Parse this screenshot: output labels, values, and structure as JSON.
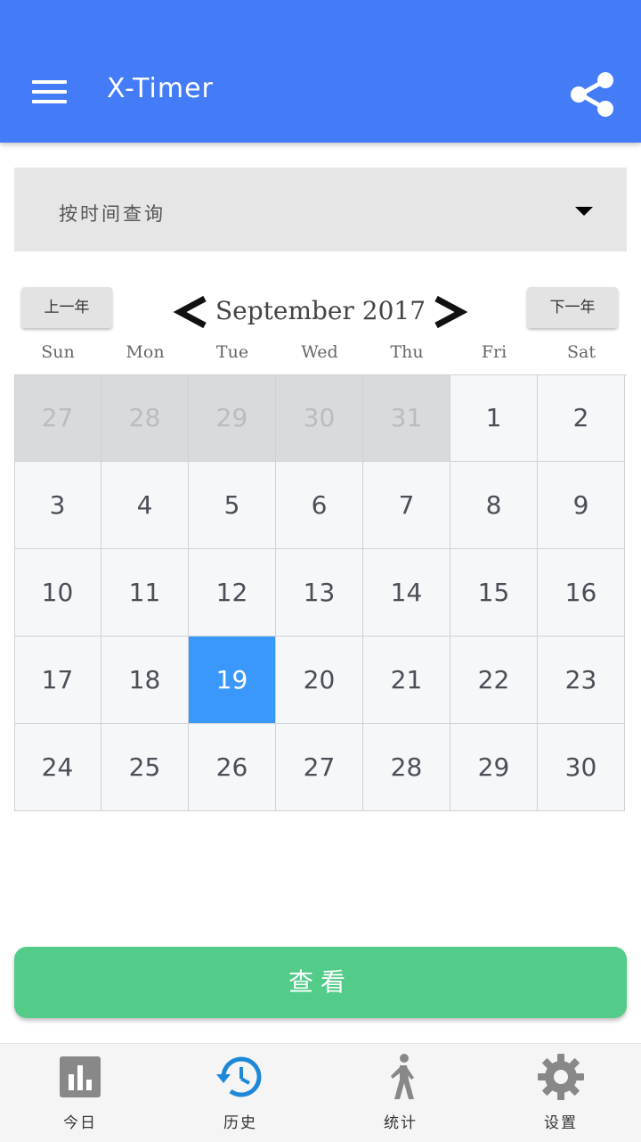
{
  "app": {
    "title": "X-Timer"
  },
  "query_filter": {
    "selected": "按时间查询"
  },
  "calendar": {
    "prev_year_label": "上一年",
    "next_year_label": "下一年",
    "month_label": "September 2017",
    "weekdays": [
      "Sun",
      "Mon",
      "Tue",
      "Wed",
      "Thu",
      "Fri",
      "Sat"
    ],
    "weeks": [
      [
        "27",
        "28",
        "29",
        "30",
        "31",
        "1",
        "2"
      ],
      [
        "3",
        "4",
        "5",
        "6",
        "7",
        "8",
        "9"
      ],
      [
        "10",
        "11",
        "12",
        "13",
        "14",
        "15",
        "16"
      ],
      [
        "17",
        "18",
        "19",
        "20",
        "21",
        "22",
        "23"
      ],
      [
        "24",
        "25",
        "26",
        "27",
        "28",
        "29",
        "30"
      ]
    ],
    "selected_day": "19"
  },
  "view_button_label": "查看",
  "bottom_nav": [
    {
      "label": "今日",
      "icon": "bar-chart-icon",
      "active": false
    },
    {
      "label": "历史",
      "icon": "history-icon",
      "active": true
    },
    {
      "label": "统计",
      "icon": "walking-person-icon",
      "active": false
    },
    {
      "label": "设置",
      "icon": "gear-icon",
      "active": false
    }
  ],
  "colors": {
    "app_bar": "#447CF8",
    "selected_day": "#3A98FC",
    "view_button": "#52CC88",
    "nav_active": "#1E88D8",
    "nav_inactive": "#888888"
  }
}
